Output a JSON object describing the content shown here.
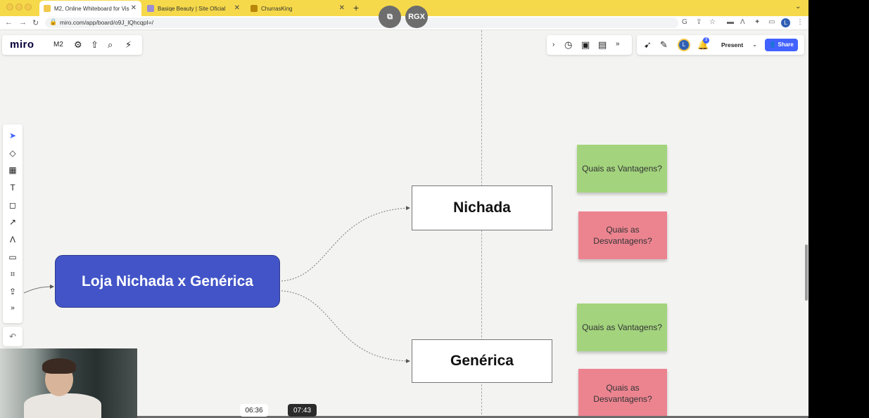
{
  "browser": {
    "tabs": [
      {
        "label": "M2, Online Whiteboard for Vis",
        "favicon_color": "#f2c94c"
      },
      {
        "label": "Basiqe Beauty | Site Oficial",
        "favicon_color": "#9b8cd6"
      },
      {
        "label": "ChurrasKing",
        "favicon_color": "#b8860b"
      }
    ],
    "new_tab": "+",
    "url": "miro.com/app/board/o9J_lQhcqpI=/",
    "profile_initial": "L"
  },
  "overlay": {
    "copy_icon": "copy-icon",
    "rgx_label": "RGX"
  },
  "miro": {
    "logo": "miro",
    "board_name": "M2",
    "notification_count": "3",
    "avatar_initial": "L",
    "present_label": "Present",
    "share_label": "Share",
    "accent": "#4262ff"
  },
  "board": {
    "main_node": "Loja Nichada x Genérica",
    "nodes": [
      "Nichada",
      "Genérica"
    ],
    "stickies": [
      {
        "text": "Quais as Vantagens?",
        "color": "green"
      },
      {
        "text": "Quais as\nDesvantagens?",
        "color": "red"
      },
      {
        "text": "Quais as Vantagens?",
        "color": "green"
      },
      {
        "text": "Quais as\nDesvantagens?",
        "color": "red"
      }
    ]
  },
  "video": {
    "time_a": "06:36",
    "time_b": "07:43"
  }
}
